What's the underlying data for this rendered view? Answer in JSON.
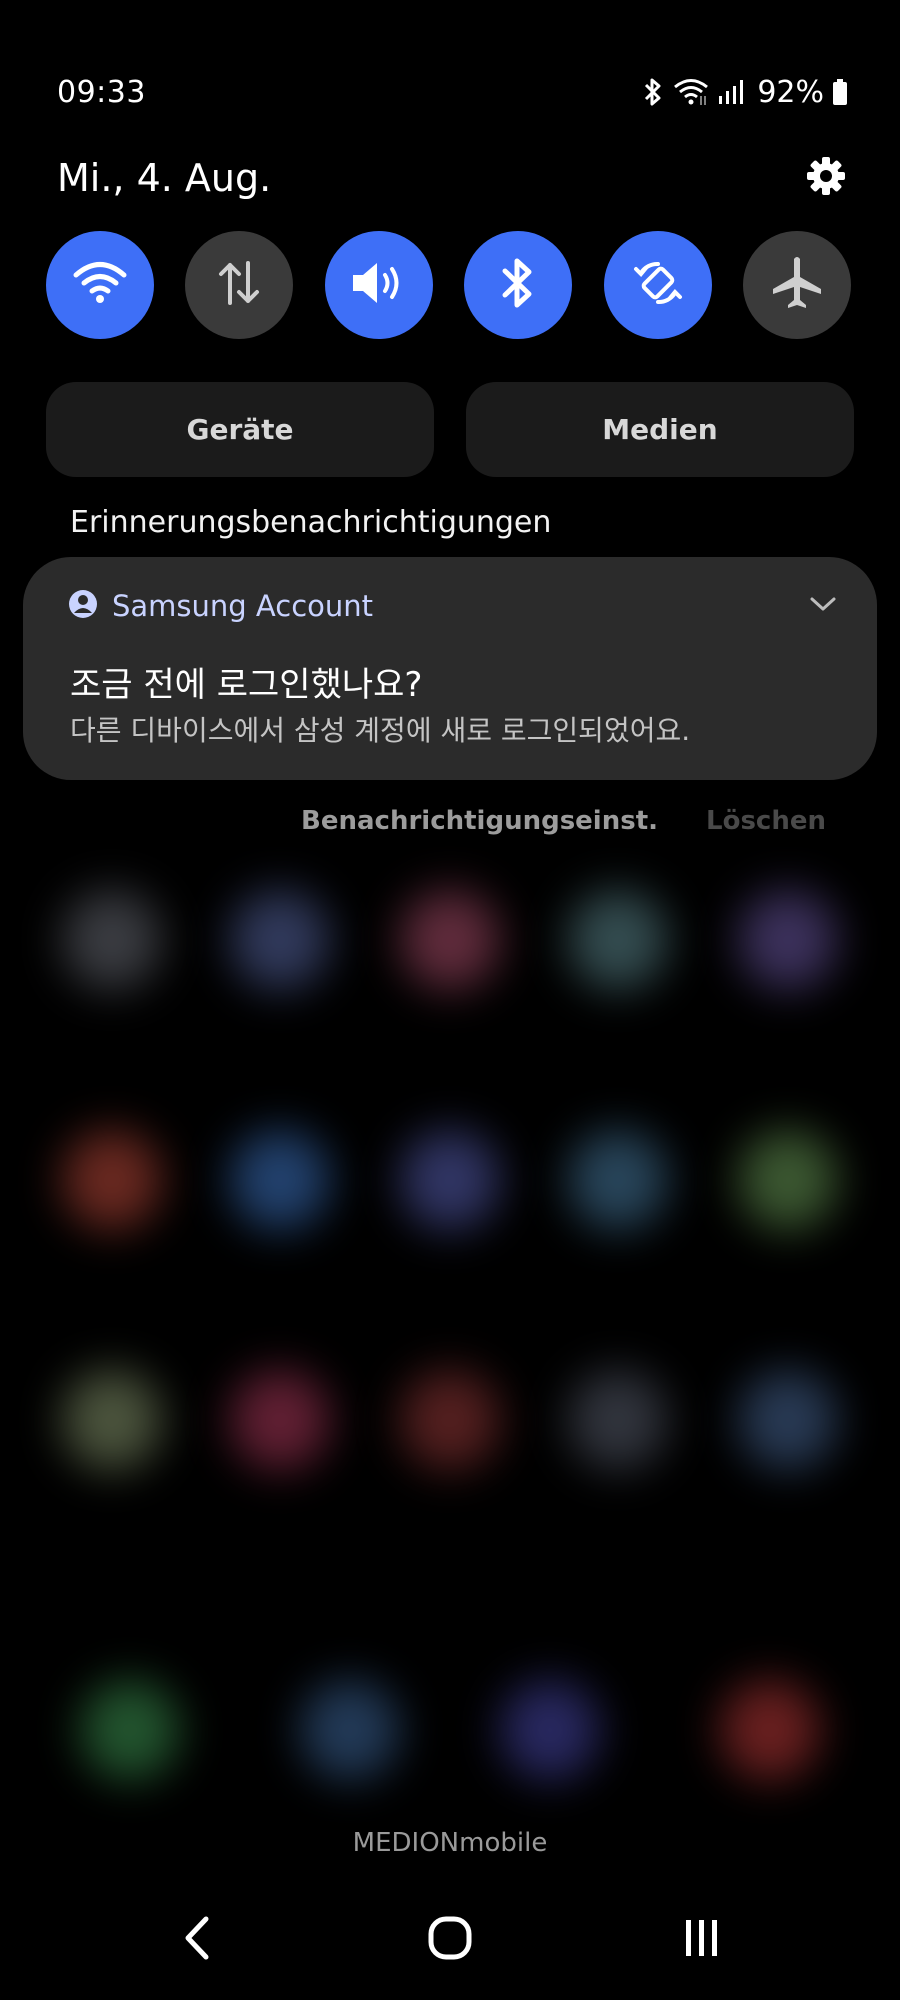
{
  "status_bar": {
    "time": "09:33",
    "battery_percent": "92%",
    "icons": [
      "bluetooth-icon",
      "wifi-icon",
      "signal-icon",
      "battery-icon"
    ]
  },
  "header": {
    "date": "Mi., 4. Aug.",
    "settings_icon": "gear-icon"
  },
  "quick_settings": [
    {
      "name": "wifi",
      "icon": "wifi-icon",
      "state": "on"
    },
    {
      "name": "mobile-data",
      "icon": "data-transfer-icon",
      "state": "off"
    },
    {
      "name": "sound",
      "icon": "speaker-icon",
      "state": "on"
    },
    {
      "name": "bluetooth",
      "icon": "bluetooth-icon",
      "state": "on"
    },
    {
      "name": "auto-rotate",
      "icon": "rotate-icon",
      "state": "on"
    },
    {
      "name": "airplane-mode",
      "icon": "airplane-icon",
      "state": "off"
    }
  ],
  "pills": {
    "devices": "Geräte",
    "media": "Medien"
  },
  "section": {
    "label": "Erinnerungsbenachrichtigungen"
  },
  "notification": {
    "app_name": "Samsung Account",
    "title": "조금 전에 로그인했나요?",
    "body": "다른 디바이스에서 삼성 계정에 새로 로그인되었어요."
  },
  "notification_actions": {
    "settings": "Benachrichtigungseinst.",
    "clear": "Löschen"
  },
  "carrier": "MEDIONmobile",
  "colors": {
    "accent": "#3e6ff7",
    "tile_off": "#3a3a3a",
    "card": "#2b2b2b",
    "pill": "#1b1b1b"
  }
}
